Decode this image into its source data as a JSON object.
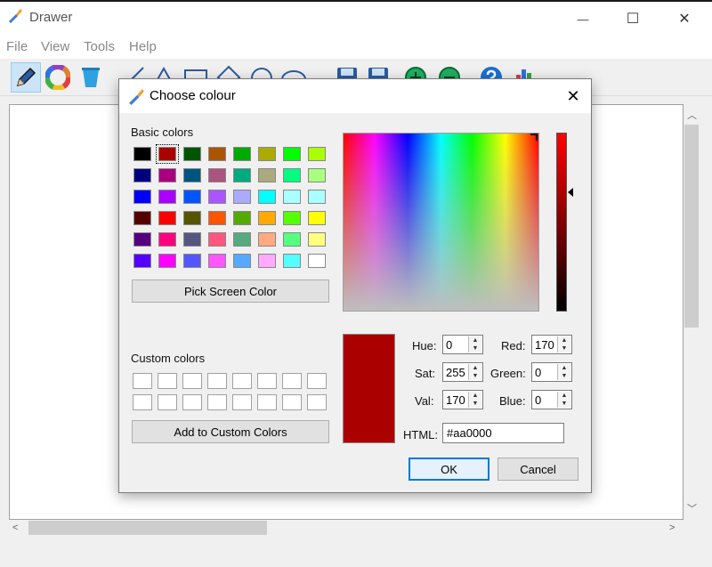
{
  "window": {
    "title": "Drawer",
    "min_glyph": "—",
    "max_glyph": "☐",
    "close_glyph": "✕"
  },
  "menu": [
    "File",
    "View",
    "Tools",
    "Help"
  ],
  "toolbar": {
    "tools": [
      "pencil-icon",
      "color-wheel-icon",
      "bucket-icon",
      "line-icon",
      "triangle-icon",
      "rectangle-icon",
      "diamond-icon",
      "circle-icon",
      "ellipse-icon",
      "save-icon",
      "save-as-icon",
      "zoom-in-icon",
      "zoom-out-icon",
      "help-icon",
      "chart-icon"
    ]
  },
  "dialog": {
    "title": "Choose colour",
    "close_glyph": "✕",
    "basic_colors_label": "Basic colors",
    "basic_colors": [
      [
        "#000000",
        "#aa0000",
        "#005500",
        "#aa5500",
        "#00aa00",
        "#aaaa00",
        "#00ff00",
        "#aaff00"
      ],
      [
        "#00007f",
        "#aa007f",
        "#00557f",
        "#aa557f",
        "#00aa7f",
        "#aaaa7f",
        "#00ff7f",
        "#aaff7f"
      ],
      [
        "#0000ff",
        "#aa00ff",
        "#0055ff",
        "#aa55ff",
        "#aaaaff",
        "#00ffff",
        "#aaffff",
        "#aaffff"
      ],
      [
        "#550000",
        "#ff0000",
        "#555500",
        "#ff5500",
        "#55aa00",
        "#ffaa00",
        "#55ff00",
        "#ffff00"
      ],
      [
        "#55007f",
        "#ff007f",
        "#55557f",
        "#ff557f",
        "#55aa7f",
        "#ffaa7f",
        "#55ff7f",
        "#ffff7f"
      ],
      [
        "#5500ff",
        "#ff00ff",
        "#5555ff",
        "#ff55ff",
        "#55aaff",
        "#ffaaff",
        "#55ffff",
        "#ffffff"
      ]
    ],
    "pick_screen_label": "Pick Screen Color",
    "custom_colors_label": "Custom colors",
    "add_custom_label": "Add to Custom Colors",
    "current_color": "#aa0000",
    "fields": {
      "hue_label": "Hue:",
      "hue": "0",
      "sat_label": "Sat:",
      "sat": "255",
      "val_label": "Val:",
      "val": "170",
      "red_label": "Red:",
      "red": "170",
      "green_label": "Green:",
      "green": "0",
      "blue_label": "Blue:",
      "blue": "0",
      "html_label": "HTML:",
      "html": "#aa0000"
    },
    "ok_label": "OK",
    "cancel_label": "Cancel"
  }
}
